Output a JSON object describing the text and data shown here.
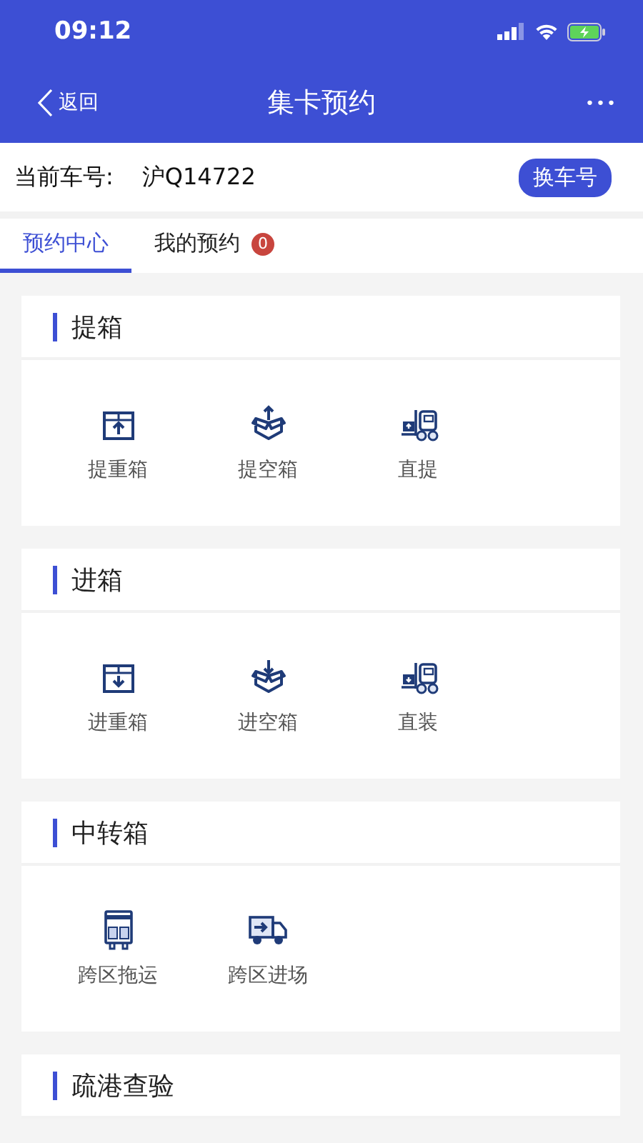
{
  "status_bar": {
    "time": "09:12"
  },
  "nav": {
    "back": "返回",
    "title": "集卡预约",
    "more": "•••"
  },
  "plate": {
    "label": "当前车号:",
    "value": "沪Q14722",
    "button": "换车号"
  },
  "tabs": [
    {
      "label": "预约中心",
      "selected": true
    },
    {
      "label": "我的预约",
      "selected": false,
      "badge": "0"
    }
  ],
  "sections": [
    {
      "title": "提箱",
      "items": [
        {
          "label": "提重箱",
          "kind": "boxup"
        },
        {
          "label": "提空箱",
          "kind": "openup"
        },
        {
          "label": "直提",
          "kind": "liftup"
        }
      ]
    },
    {
      "title": "进箱",
      "items": [
        {
          "label": "进重箱",
          "kind": "boxdown"
        },
        {
          "label": "进空箱",
          "kind": "opendown"
        },
        {
          "label": "直装",
          "kind": "liftdown"
        }
      ]
    },
    {
      "title": "中转箱",
      "items": [
        {
          "label": "跨区拖运",
          "kind": "trailer"
        },
        {
          "label": "跨区进场",
          "kind": "truck"
        }
      ]
    },
    {
      "title": "疏港查验"
    }
  ]
}
